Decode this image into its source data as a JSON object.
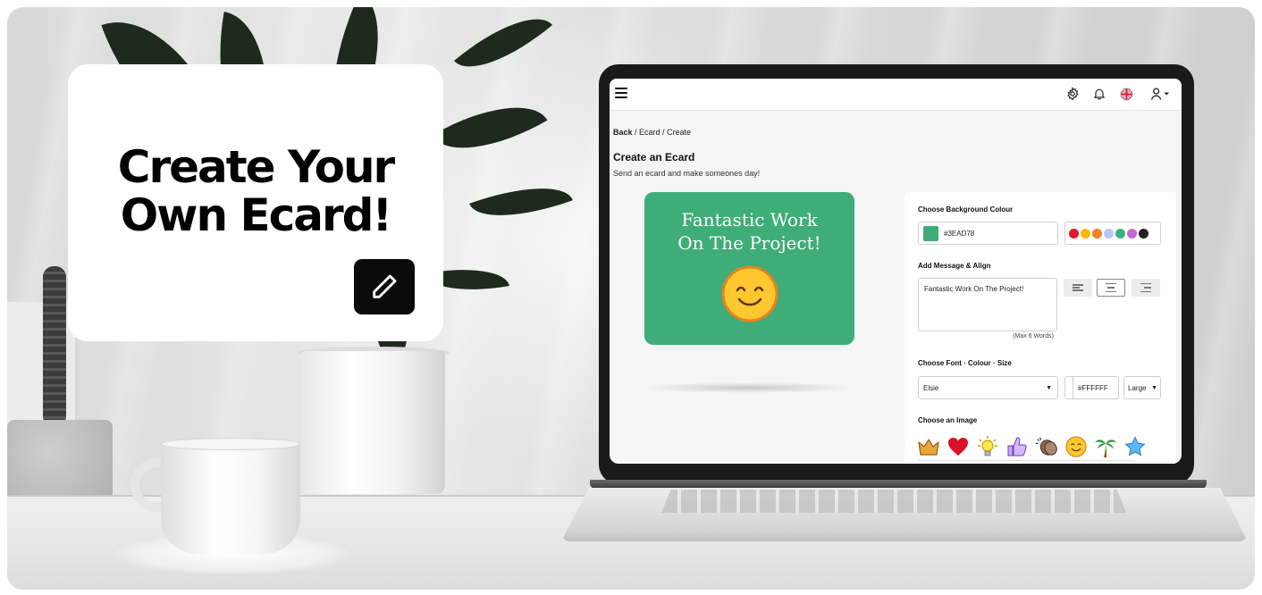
{
  "hero": {
    "headline_line1": "Create Your",
    "headline_line2": "Own Ecard!",
    "edit_icon": "pencil-icon"
  },
  "topbar": {
    "menu_icon": "hamburger-icon",
    "icons": [
      "gear-icon",
      "bell-icon",
      "uk-flag-icon",
      "user-icon"
    ]
  },
  "breadcrumb": {
    "back": "Back",
    "path": " / Ecard / Create"
  },
  "page": {
    "title": "Create an Ecard",
    "subtitle": "Send an ecard and make someones day!"
  },
  "ecard": {
    "message_line1": "Fantastic Work",
    "message_line2": "On The Project!",
    "background_color": "#3EAD78",
    "text_color": "#FFFFFF",
    "image": "smiley-icon"
  },
  "editor": {
    "background_label": "Choose Background Colour",
    "background_value": "#3EAD78",
    "palette": [
      "#e0182d",
      "#f6b800",
      "#f0802a",
      "#b9c8f4",
      "#39b27a",
      "#c667d6",
      "#222222"
    ],
    "message_label": "Add Message & Align",
    "message_value": "Fantastic Work On The Project!",
    "message_hint": "(Max 6 Words)",
    "font_label": "Choose Font · Colour · Size",
    "font_value": "Elsie",
    "font_color_value": "#FFFFFF",
    "size_value": "Large",
    "image_label": "Choose an Image",
    "images": [
      "crown-icon",
      "heart-icon",
      "lightbulb-icon",
      "thumbs-up-icon",
      "clapping-hands-icon",
      "smiley-icon",
      "palm-tree-icon",
      "star-icon"
    ]
  }
}
